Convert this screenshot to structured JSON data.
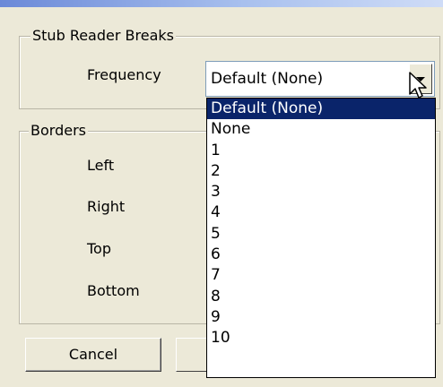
{
  "stub_group": {
    "title": "Stub Reader Breaks",
    "frequency_label": "Frequency",
    "frequency_value": "Default  (None)"
  },
  "frequency_options": [
    {
      "label": "Default  (None)",
      "selected": true
    },
    {
      "label": "None",
      "selected": false
    },
    {
      "label": "1",
      "selected": false
    },
    {
      "label": "2",
      "selected": false
    },
    {
      "label": "3",
      "selected": false
    },
    {
      "label": "4",
      "selected": false
    },
    {
      "label": "5",
      "selected": false
    },
    {
      "label": "6",
      "selected": false
    },
    {
      "label": "7",
      "selected": false
    },
    {
      "label": "8",
      "selected": false
    },
    {
      "label": "9",
      "selected": false
    },
    {
      "label": "10",
      "selected": false
    }
  ],
  "borders_group": {
    "title": "Borders",
    "left_label": "Left",
    "right_label": "Right",
    "top_label": "Top",
    "bottom_label": "Bottom"
  },
  "buttons": {
    "cancel_label": "Cancel"
  },
  "icons": {
    "combo_arrow": "chevron-down-icon",
    "cursor": "mouse-pointer-icon"
  },
  "colors": {
    "dialog_background": "#ece9d8",
    "selection_highlight": "#0a246a",
    "title_bar": "#6b89d8"
  }
}
